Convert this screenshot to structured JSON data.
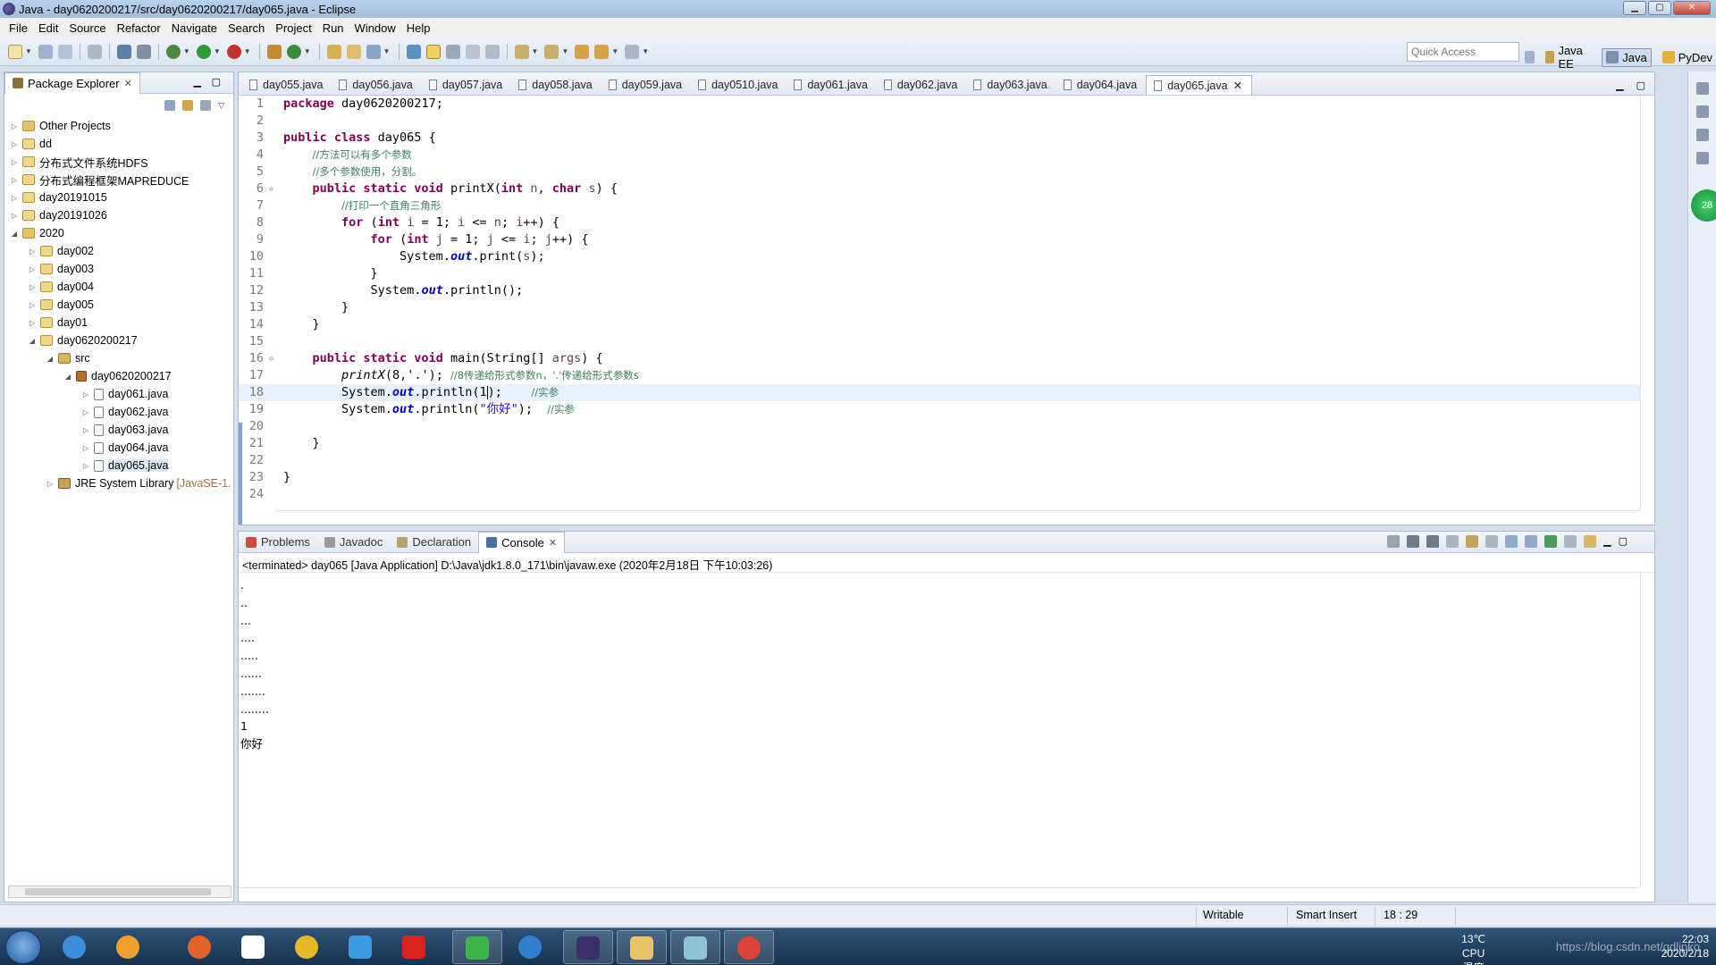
{
  "window": {
    "title": "Java - day0620200217/src/day0620200217/day065.java - Eclipse"
  },
  "menu": [
    "File",
    "Edit",
    "Source",
    "Refactor",
    "Navigate",
    "Search",
    "Project",
    "Run",
    "Window",
    "Help"
  ],
  "toolbar": {
    "quick_access_placeholder": "Quick Access",
    "perspectives": [
      {
        "label": "Java EE",
        "active": false
      },
      {
        "label": "Java",
        "active": true
      },
      {
        "label": "PyDev",
        "active": false
      }
    ]
  },
  "package_explorer": {
    "title": "Package Explorer",
    "tree": [
      {
        "label": "Other Projects",
        "level": 0,
        "expanded": false,
        "icon": "folder"
      },
      {
        "label": "dd",
        "level": 0,
        "expanded": false,
        "icon": "project"
      },
      {
        "label": "分布式文件系统HDFS",
        "level": 0,
        "expanded": false,
        "icon": "project"
      },
      {
        "label": "分布式编程框架MAPREDUCE",
        "level": 0,
        "expanded": false,
        "icon": "project"
      },
      {
        "label": "day20191015",
        "level": 0,
        "expanded": false,
        "icon": "project"
      },
      {
        "label": "day20191026",
        "level": 0,
        "expanded": false,
        "icon": "project"
      },
      {
        "label": "2020",
        "level": 0,
        "expanded": true,
        "icon": "folder"
      },
      {
        "label": "day002",
        "level": 1,
        "expanded": false,
        "icon": "project"
      },
      {
        "label": "day003",
        "level": 1,
        "expanded": false,
        "icon": "project"
      },
      {
        "label": "day004",
        "level": 1,
        "expanded": false,
        "icon": "project"
      },
      {
        "label": "day005",
        "level": 1,
        "expanded": false,
        "icon": "project"
      },
      {
        "label": "day01",
        "level": 1,
        "expanded": false,
        "icon": "project"
      },
      {
        "label": "day0620200217",
        "level": 1,
        "expanded": true,
        "icon": "project"
      },
      {
        "label": "src",
        "level": 2,
        "expanded": true,
        "icon": "srcfolder"
      },
      {
        "label": "day0620200217",
        "level": 3,
        "expanded": true,
        "icon": "pkg"
      },
      {
        "label": "day061.java",
        "level": 4,
        "expanded": false,
        "icon": "jfile"
      },
      {
        "label": "day062.java",
        "level": 4,
        "expanded": false,
        "icon": "jfile"
      },
      {
        "label": "day063.java",
        "level": 4,
        "expanded": false,
        "icon": "jfile"
      },
      {
        "label": "day064.java",
        "level": 4,
        "expanded": false,
        "icon": "jfile"
      },
      {
        "label": "day065.java",
        "level": 4,
        "expanded": false,
        "icon": "jfile",
        "selected": true
      },
      {
        "label": "JRE System Library",
        "decoration": "[JavaSE-1.",
        "level": 2,
        "expanded": false,
        "icon": "lib"
      }
    ]
  },
  "editor": {
    "tabs": [
      "day055.java",
      "day056.java",
      "day057.java",
      "day058.java",
      "day059.java",
      "day0510.java",
      "day061.java",
      "day062.java",
      "day063.java",
      "day064.java",
      "day065.java"
    ],
    "active_tab": "day065.java",
    "current_line": 18,
    "lines": [
      [
        [
          "kw",
          "package"
        ],
        [
          "t",
          " day0620200217;"
        ]
      ],
      [],
      [
        [
          "kw",
          "public class"
        ],
        [
          "t",
          " day065 {"
        ]
      ],
      [
        [
          "t",
          "    "
        ],
        [
          "cm",
          "//方法可以有多个参数"
        ]
      ],
      [
        [
          "t",
          "    "
        ],
        [
          "cm",
          "//多个参数使用，分割。"
        ]
      ],
      [
        [
          "t",
          "    "
        ],
        [
          "kw",
          "public static void"
        ],
        [
          "t",
          " printX("
        ],
        [
          "kw",
          "int"
        ],
        [
          "t",
          " "
        ],
        [
          "var",
          "n"
        ],
        [
          "t",
          ", "
        ],
        [
          "kw",
          "char"
        ],
        [
          "t",
          " "
        ],
        [
          "var",
          "s"
        ],
        [
          "t",
          ") {"
        ]
      ],
      [
        [
          "t",
          "        "
        ],
        [
          "cm",
          "//打印一个直角三角形"
        ]
      ],
      [
        [
          "t",
          "        "
        ],
        [
          "kw",
          "for"
        ],
        [
          "t",
          " ("
        ],
        [
          "kw",
          "int"
        ],
        [
          "t",
          " "
        ],
        [
          "var",
          "i"
        ],
        [
          "t",
          " = 1; "
        ],
        [
          "var",
          "i"
        ],
        [
          "t",
          " <= "
        ],
        [
          "var",
          "n"
        ],
        [
          "t",
          "; "
        ],
        [
          "var",
          "i"
        ],
        [
          "t",
          "++) {"
        ]
      ],
      [
        [
          "t",
          "            "
        ],
        [
          "kw",
          "for"
        ],
        [
          "t",
          " ("
        ],
        [
          "kw",
          "int"
        ],
        [
          "t",
          " "
        ],
        [
          "var",
          "j"
        ],
        [
          "t",
          " = 1; "
        ],
        [
          "var",
          "j"
        ],
        [
          "t",
          " <= "
        ],
        [
          "var",
          "i"
        ],
        [
          "t",
          "; "
        ],
        [
          "var",
          "j"
        ],
        [
          "t",
          "++) {"
        ]
      ],
      [
        [
          "t",
          "                System."
        ],
        [
          "fld",
          "out"
        ],
        [
          "t",
          ".print("
        ],
        [
          "var",
          "s"
        ],
        [
          "t",
          ");"
        ]
      ],
      [
        [
          "t",
          "            }"
        ]
      ],
      [
        [
          "t",
          "            System."
        ],
        [
          "fld",
          "out"
        ],
        [
          "t",
          ".println();"
        ]
      ],
      [
        [
          "t",
          "        }"
        ]
      ],
      [
        [
          "t",
          "    }"
        ]
      ],
      [],
      [
        [
          "t",
          "    "
        ],
        [
          "kw",
          "public static void"
        ],
        [
          "t",
          " main(String[] "
        ],
        [
          "var",
          "args"
        ],
        [
          "t",
          ") {"
        ]
      ],
      [
        [
          "t",
          "        "
        ],
        [
          "mcall",
          "printX"
        ],
        [
          "t",
          "(8,'.'); "
        ],
        [
          "cm",
          "//8传递给形式参数n，'.'传递给形式参数s"
        ]
      ],
      [
        [
          "t",
          "        System."
        ],
        [
          "fld",
          "out"
        ],
        [
          "t",
          ".println(1"
        ],
        [
          "cursor",
          ""
        ],
        [
          "t",
          ");    "
        ],
        [
          "cm",
          "//实参"
        ]
      ],
      [
        [
          "t",
          "        System."
        ],
        [
          "fld",
          "out"
        ],
        [
          "t",
          ".println("
        ],
        [
          "str",
          "\"你好\""
        ],
        [
          "t",
          ");  "
        ],
        [
          "cm",
          "//实参"
        ]
      ],
      [],
      [
        [
          "t",
          "    }"
        ]
      ],
      [],
      [
        [
          "t",
          "}"
        ]
      ],
      []
    ]
  },
  "bottom_panel": {
    "tabs": [
      {
        "label": "Problems",
        "active": false
      },
      {
        "label": "Javadoc",
        "active": false
      },
      {
        "label": "Declaration",
        "active": false
      },
      {
        "label": "Console",
        "active": true
      }
    ],
    "header": "<terminated> day065 [Java Application] D:\\Java\\jdk1.8.0_171\\bin\\javaw.exe (2020年2月18日 下午10:03:26)",
    "output": [
      ".",
      "..",
      "...",
      "....",
      ".....",
      "......",
      ".......",
      "........",
      "1",
      "你好"
    ]
  },
  "status_bar": {
    "writable": "Writable",
    "insert_mode": "Smart Insert",
    "position": "18 : 29"
  },
  "taskbar": {
    "weather_temp": "13℃",
    "weather_label": "CPU温度",
    "time": "22:03",
    "date": "2020/2/18",
    "watermark": "https://blog.csdn.net/gdlipko"
  },
  "side_badge": "28",
  "colors": {
    "keyword": "#7f0055",
    "comment": "#3f7f5f",
    "string": "#2a00ff",
    "field": "#0000c0",
    "current_line": "#e8f2fe"
  }
}
